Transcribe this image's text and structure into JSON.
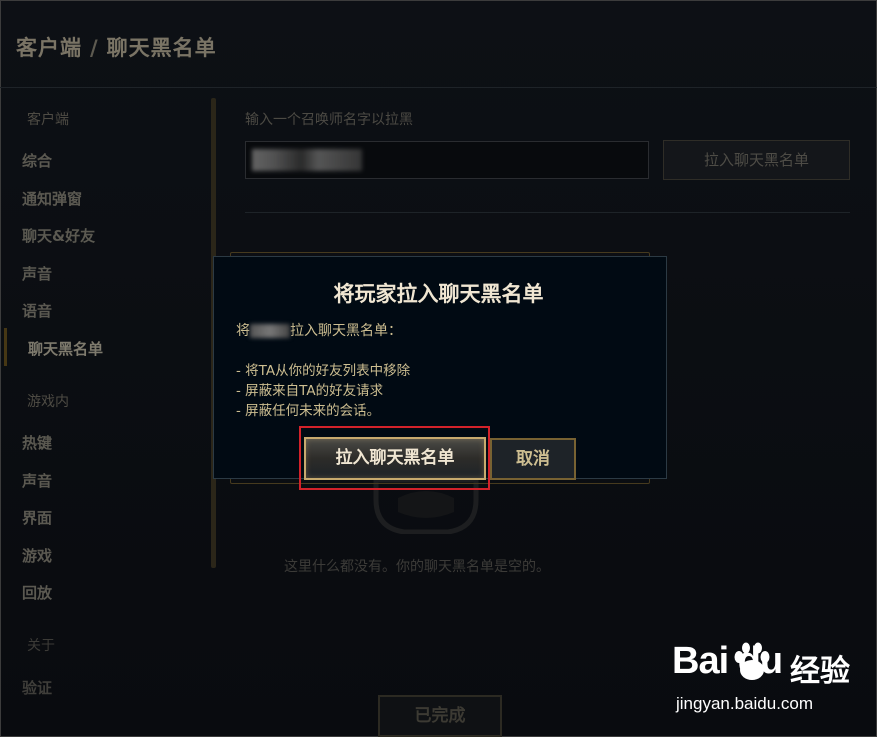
{
  "header": {
    "section": "客户端",
    "separator": "/",
    "page": "聊天黑名单"
  },
  "sidebar": {
    "client_label": "客户端",
    "client_items": [
      "综合",
      "通知弹窗",
      "聊天&好友",
      "声音",
      "语音",
      "聊天黑名单"
    ],
    "ingame_label": "游戏内",
    "ingame_items": [
      "热键",
      "声音",
      "界面",
      "游戏",
      "回放"
    ],
    "about_label": "关于",
    "about_items": [
      "验证"
    ]
  },
  "blacklist": {
    "input_label": "输入一个召唤师名字以拉黑",
    "add_button": "拉入聊天黑名单",
    "empty_text": "这里什么都没有。你的聊天黑名单是空的。"
  },
  "footer": {
    "done_button": "已完成"
  },
  "dialog": {
    "title": "将玩家拉入聊天黑名单",
    "line_prefix": "将",
    "line_suffix": "拉入聊天黑名单：",
    "effects": [
      "- 将TA从你的好友列表中移除",
      "- 屏蔽来自TA的好友请求",
      "- 屏蔽任何未来的会话。"
    ],
    "confirm_button": "拉入聊天黑名单",
    "cancel_button": "取消"
  },
  "watermark": {
    "logo": "Bai du",
    "brand": "经验",
    "url": "jingyan.baidu.com"
  },
  "colors": {
    "highlight": "#d3222a",
    "gold": "#c8aa6e",
    "dialog_bg": "#010a13"
  }
}
